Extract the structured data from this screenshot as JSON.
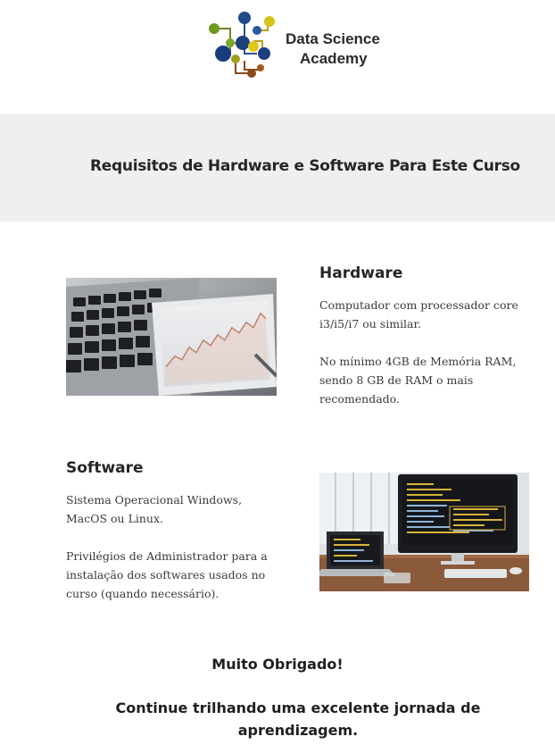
{
  "brand": {
    "line1": "Data Science",
    "line2": "Academy"
  },
  "banner": {
    "title": "Requisitos de Hardware e Software Para Este Curso"
  },
  "hardware": {
    "heading": "Hardware",
    "p1": "Computador com processador core i3/i5/i7 ou similar.",
    "p2": "No mínimo 4GB de Memória RAM, sendo 8 GB de RAM o mais recomendado."
  },
  "software": {
    "heading": "Software",
    "p1": "Sistema Operacional Windows, MacOS ou Linux.",
    "p2": "Privilégios de Administrador para a instalação dos softwares usados no curso (quando necessário)."
  },
  "closing": {
    "thanks": "Muito Obrigado!",
    "message": "Continue trilhando uma excelente jornada de aprendizagem."
  },
  "colors": {
    "banner_bg": "#eeeff1",
    "heading_text": "#262626",
    "body_text": "#3a3a3a"
  }
}
